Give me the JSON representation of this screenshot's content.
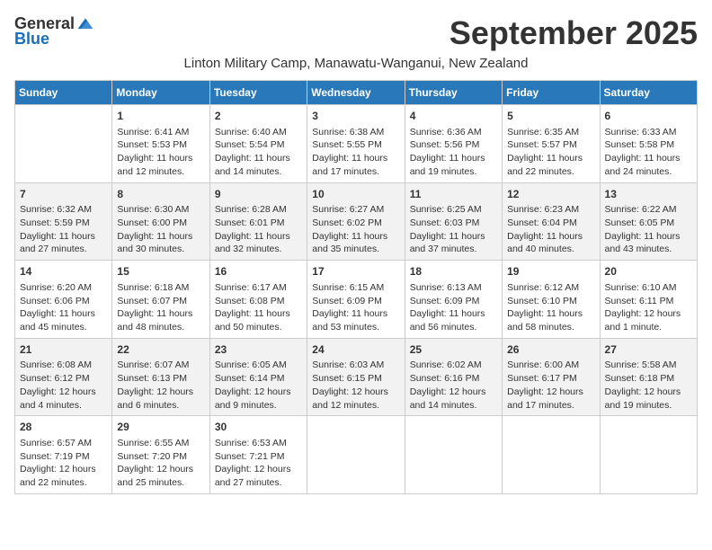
{
  "header": {
    "logo_general": "General",
    "logo_blue": "Blue",
    "month_title": "September 2025",
    "location": "Linton Military Camp, Manawatu-Wanganui, New Zealand"
  },
  "weekdays": [
    "Sunday",
    "Monday",
    "Tuesday",
    "Wednesday",
    "Thursday",
    "Friday",
    "Saturday"
  ],
  "weeks": [
    [
      {
        "day": "",
        "sunrise": "",
        "sunset": "",
        "daylight": ""
      },
      {
        "day": "1",
        "sunrise": "Sunrise: 6:41 AM",
        "sunset": "Sunset: 5:53 PM",
        "daylight": "Daylight: 11 hours and 12 minutes."
      },
      {
        "day": "2",
        "sunrise": "Sunrise: 6:40 AM",
        "sunset": "Sunset: 5:54 PM",
        "daylight": "Daylight: 11 hours and 14 minutes."
      },
      {
        "day": "3",
        "sunrise": "Sunrise: 6:38 AM",
        "sunset": "Sunset: 5:55 PM",
        "daylight": "Daylight: 11 hours and 17 minutes."
      },
      {
        "day": "4",
        "sunrise": "Sunrise: 6:36 AM",
        "sunset": "Sunset: 5:56 PM",
        "daylight": "Daylight: 11 hours and 19 minutes."
      },
      {
        "day": "5",
        "sunrise": "Sunrise: 6:35 AM",
        "sunset": "Sunset: 5:57 PM",
        "daylight": "Daylight: 11 hours and 22 minutes."
      },
      {
        "day": "6",
        "sunrise": "Sunrise: 6:33 AM",
        "sunset": "Sunset: 5:58 PM",
        "daylight": "Daylight: 11 hours and 24 minutes."
      }
    ],
    [
      {
        "day": "7",
        "sunrise": "Sunrise: 6:32 AM",
        "sunset": "Sunset: 5:59 PM",
        "daylight": "Daylight: 11 hours and 27 minutes."
      },
      {
        "day": "8",
        "sunrise": "Sunrise: 6:30 AM",
        "sunset": "Sunset: 6:00 PM",
        "daylight": "Daylight: 11 hours and 30 minutes."
      },
      {
        "day": "9",
        "sunrise": "Sunrise: 6:28 AM",
        "sunset": "Sunset: 6:01 PM",
        "daylight": "Daylight: 11 hours and 32 minutes."
      },
      {
        "day": "10",
        "sunrise": "Sunrise: 6:27 AM",
        "sunset": "Sunset: 6:02 PM",
        "daylight": "Daylight: 11 hours and 35 minutes."
      },
      {
        "day": "11",
        "sunrise": "Sunrise: 6:25 AM",
        "sunset": "Sunset: 6:03 PM",
        "daylight": "Daylight: 11 hours and 37 minutes."
      },
      {
        "day": "12",
        "sunrise": "Sunrise: 6:23 AM",
        "sunset": "Sunset: 6:04 PM",
        "daylight": "Daylight: 11 hours and 40 minutes."
      },
      {
        "day": "13",
        "sunrise": "Sunrise: 6:22 AM",
        "sunset": "Sunset: 6:05 PM",
        "daylight": "Daylight: 11 hours and 43 minutes."
      }
    ],
    [
      {
        "day": "14",
        "sunrise": "Sunrise: 6:20 AM",
        "sunset": "Sunset: 6:06 PM",
        "daylight": "Daylight: 11 hours and 45 minutes."
      },
      {
        "day": "15",
        "sunrise": "Sunrise: 6:18 AM",
        "sunset": "Sunset: 6:07 PM",
        "daylight": "Daylight: 11 hours and 48 minutes."
      },
      {
        "day": "16",
        "sunrise": "Sunrise: 6:17 AM",
        "sunset": "Sunset: 6:08 PM",
        "daylight": "Daylight: 11 hours and 50 minutes."
      },
      {
        "day": "17",
        "sunrise": "Sunrise: 6:15 AM",
        "sunset": "Sunset: 6:09 PM",
        "daylight": "Daylight: 11 hours and 53 minutes."
      },
      {
        "day": "18",
        "sunrise": "Sunrise: 6:13 AM",
        "sunset": "Sunset: 6:09 PM",
        "daylight": "Daylight: 11 hours and 56 minutes."
      },
      {
        "day": "19",
        "sunrise": "Sunrise: 6:12 AM",
        "sunset": "Sunset: 6:10 PM",
        "daylight": "Daylight: 11 hours and 58 minutes."
      },
      {
        "day": "20",
        "sunrise": "Sunrise: 6:10 AM",
        "sunset": "Sunset: 6:11 PM",
        "daylight": "Daylight: 12 hours and 1 minute."
      }
    ],
    [
      {
        "day": "21",
        "sunrise": "Sunrise: 6:08 AM",
        "sunset": "Sunset: 6:12 PM",
        "daylight": "Daylight: 12 hours and 4 minutes."
      },
      {
        "day": "22",
        "sunrise": "Sunrise: 6:07 AM",
        "sunset": "Sunset: 6:13 PM",
        "daylight": "Daylight: 12 hours and 6 minutes."
      },
      {
        "day": "23",
        "sunrise": "Sunrise: 6:05 AM",
        "sunset": "Sunset: 6:14 PM",
        "daylight": "Daylight: 12 hours and 9 minutes."
      },
      {
        "day": "24",
        "sunrise": "Sunrise: 6:03 AM",
        "sunset": "Sunset: 6:15 PM",
        "daylight": "Daylight: 12 hours and 12 minutes."
      },
      {
        "day": "25",
        "sunrise": "Sunrise: 6:02 AM",
        "sunset": "Sunset: 6:16 PM",
        "daylight": "Daylight: 12 hours and 14 minutes."
      },
      {
        "day": "26",
        "sunrise": "Sunrise: 6:00 AM",
        "sunset": "Sunset: 6:17 PM",
        "daylight": "Daylight: 12 hours and 17 minutes."
      },
      {
        "day": "27",
        "sunrise": "Sunrise: 5:58 AM",
        "sunset": "Sunset: 6:18 PM",
        "daylight": "Daylight: 12 hours and 19 minutes."
      }
    ],
    [
      {
        "day": "28",
        "sunrise": "Sunrise: 6:57 AM",
        "sunset": "Sunset: 7:19 PM",
        "daylight": "Daylight: 12 hours and 22 minutes."
      },
      {
        "day": "29",
        "sunrise": "Sunrise: 6:55 AM",
        "sunset": "Sunset: 7:20 PM",
        "daylight": "Daylight: 12 hours and 25 minutes."
      },
      {
        "day": "30",
        "sunrise": "Sunrise: 6:53 AM",
        "sunset": "Sunset: 7:21 PM",
        "daylight": "Daylight: 12 hours and 27 minutes."
      },
      {
        "day": "",
        "sunrise": "",
        "sunset": "",
        "daylight": ""
      },
      {
        "day": "",
        "sunrise": "",
        "sunset": "",
        "daylight": ""
      },
      {
        "day": "",
        "sunrise": "",
        "sunset": "",
        "daylight": ""
      },
      {
        "day": "",
        "sunrise": "",
        "sunset": "",
        "daylight": ""
      }
    ]
  ]
}
